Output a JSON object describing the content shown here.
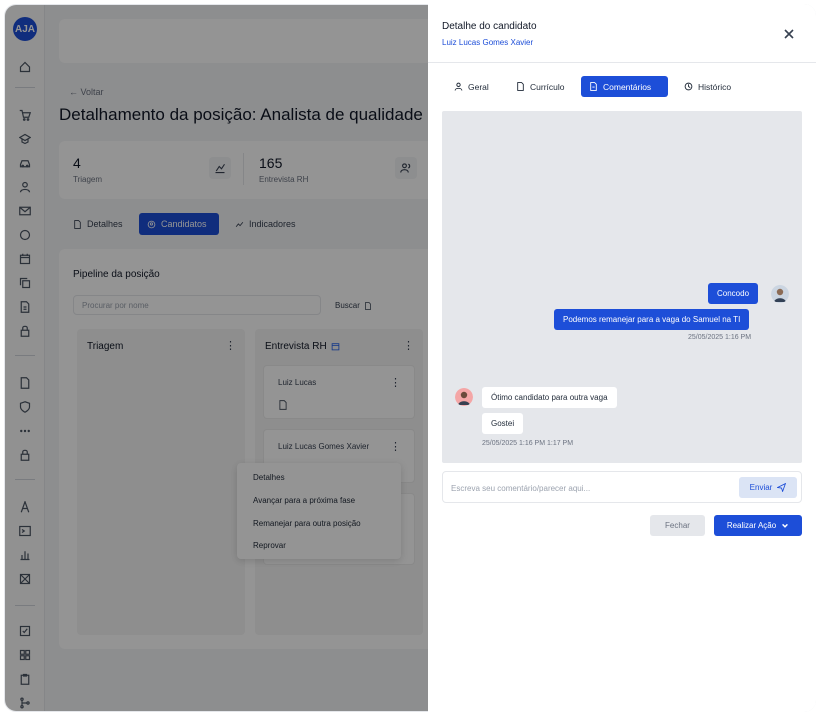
{
  "app": {
    "logo_text": "AJA"
  },
  "sidebar": {
    "icons": [
      "home-icon",
      "cart-icon",
      "graduation-cap-icon",
      "car-icon",
      "user-icon",
      "mail-icon",
      "chat-icon",
      "calendar-icon",
      "copy-icon",
      "document-icon",
      "lock-icon",
      "file-icon",
      "shield-icon",
      "more-icon",
      "lock-icon",
      "font-icon",
      "terminal-icon",
      "bar-chart-icon",
      "box-icon",
      "checkbox-icon",
      "grid-icon",
      "clipboard-icon",
      "git-icon"
    ]
  },
  "background_page": {
    "back_label": "← Voltar",
    "title": "Detalhamento da posição: Analista de qualidade",
    "stats": [
      {
        "value": "4",
        "label": "Triagem"
      },
      {
        "value": "165",
        "label": "Entrevista RH"
      }
    ],
    "tabs": [
      {
        "label": "Detalhes",
        "active": false
      },
      {
        "label": "Candidatos",
        "active": true
      },
      {
        "label": "Indicadores",
        "active": false
      }
    ],
    "pipeline": {
      "title": "Pipeline da posição",
      "search_placeholder": "Procurar por nome",
      "search_button": "Buscar",
      "columns": [
        {
          "title": "Triagem"
        },
        {
          "title": "Entrevista RH"
        }
      ],
      "cards": [
        {
          "name": "Luiz Lucas"
        },
        {
          "name": "Luiz Lucas Gomes Xavier"
        }
      ]
    },
    "context_menu": [
      "Detalhes",
      "Avançar para a próxima fase",
      "Remanejar para outra posição",
      "Reprovar"
    ]
  },
  "drawer": {
    "title": "Detalhe do candidato",
    "candidate_name": "Luiz Lucas Gomes Xavier",
    "tabs": [
      {
        "label": "Geral",
        "icon": "user-icon",
        "active": false
      },
      {
        "label": "Currículo",
        "icon": "document-icon",
        "active": false
      },
      {
        "label": "Comentários",
        "icon": "document-icon",
        "active": true
      },
      {
        "label": "Histórico",
        "icon": "history-icon",
        "active": false
      }
    ],
    "messages_out": [
      {
        "text": "Concodo"
      },
      {
        "text": "Podemos remanejar para a vaga do Samuel na TI"
      }
    ],
    "messages_out_time": "25/05/2025 1:16 PM",
    "messages_in": [
      {
        "text": "Ótimo candidato para outra vaga"
      },
      {
        "text": "Gostei"
      }
    ],
    "messages_in_time": "25/05/2025 1:16 PM 1:17 PM",
    "composer": {
      "placeholder": "Escreva seu comentário/parecer aqui...",
      "send_label": "Enviar"
    },
    "footer": {
      "close_label": "Fechar",
      "action_label": "Realizar Ação"
    },
    "accent_color": "#1d4ed8"
  }
}
